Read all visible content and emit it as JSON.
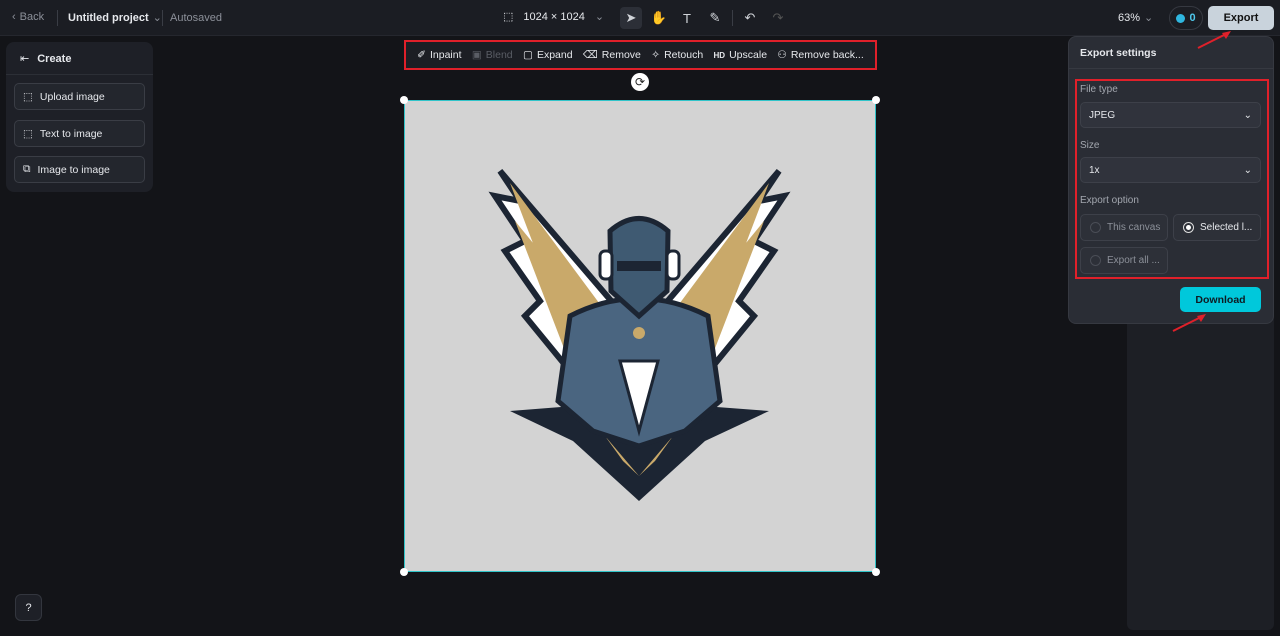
{
  "topbar": {
    "back": "Back",
    "project": "Untitled project",
    "status": "Autosaved",
    "dimensions": "1024 × 1024",
    "zoom": "63%",
    "credits": "0",
    "export": "Export"
  },
  "left_panel": {
    "title": "Create",
    "items": [
      "Upload image",
      "Text to image",
      "Image to image"
    ]
  },
  "toolbar": {
    "items": [
      "Inpaint",
      "Blend",
      "Expand",
      "Remove",
      "Retouch",
      "Upscale",
      "Remove back..."
    ],
    "upscale_badge": "HD"
  },
  "export_settings": {
    "title": "Export settings",
    "file_type_label": "File type",
    "file_type": "JPEG",
    "size_label": "Size",
    "size": "1x",
    "option_label": "Export option",
    "options": [
      "This canvas",
      "Selected l...",
      "Export all ..."
    ],
    "selected_option": "Selected l...",
    "download": "Download"
  },
  "colors": {
    "accent": "#00c8db",
    "highlight": "#e0202a",
    "selection": "#30c4c9"
  }
}
